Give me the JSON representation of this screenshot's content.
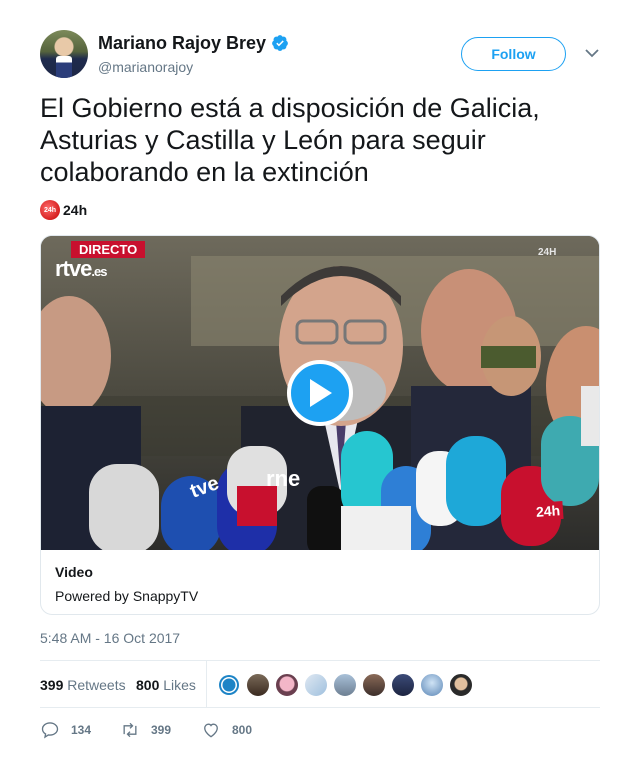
{
  "user": {
    "name": "Mariano Rajoy Brey",
    "handle": "@marianorajoy",
    "verified": true
  },
  "follow_button": {
    "label": "Follow"
  },
  "tweet": {
    "lines": [
      "El Gobierno está a disposición de Galicia,",
      "Asturias y Castilla y León para seguir",
      "colaborando en la extinción"
    ]
  },
  "source": {
    "logo_text": "24h",
    "name": "24h"
  },
  "video": {
    "overlay_directo": "DIRECTO",
    "overlay_rtve": "rtve",
    "overlay_rtve_suffix": ".es",
    "overlay_channel_top": "24H",
    "mic_label_24h": "24h",
    "mic_label_tve": "tve",
    "mic_label_rne": "rne",
    "card_title": "Video",
    "card_subtitle": "Powered by SnappyTV"
  },
  "timestamp": "5:48 AM - 16 Oct 2017",
  "stats": {
    "retweets_count": "399",
    "retweets_label": "Retweets",
    "likes_count": "800",
    "likes_label": "Likes"
  },
  "actions": {
    "replies": "134",
    "retweets": "399",
    "likes": "800"
  },
  "colors": {
    "accent": "#1da1f2",
    "text": "#14171a",
    "muted": "#657786",
    "border": "#e6ecf0"
  },
  "icons": [
    "verified-badge-icon",
    "chevron-down-icon",
    "play-icon",
    "reply-icon",
    "retweet-icon",
    "heart-icon"
  ]
}
